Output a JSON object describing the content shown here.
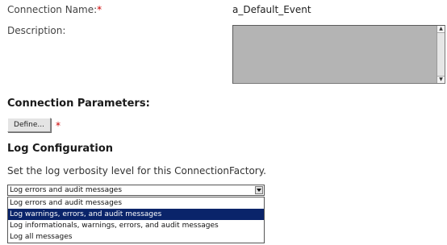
{
  "connection_name": {
    "label": "Connection Name:",
    "required_mark": "*",
    "value": "a_Default_Event"
  },
  "description": {
    "label": "Description:",
    "value": ""
  },
  "connection_parameters": {
    "heading": "Connection Parameters:",
    "define_label": "Define...",
    "required_mark": "*"
  },
  "log_configuration": {
    "heading": "Log Configuration",
    "description": "Set the log verbosity level for this ConnectionFactory.",
    "selected_value": "Log errors and audit messages",
    "options": [
      "Log errors and audit messages",
      "Log warnings, errors, and audit messages",
      "Log informationals, warnings, errors, and audit messages",
      "Log all messages"
    ],
    "highlighted_index": 1
  },
  "colors": {
    "required": "#cc0000",
    "selection_background": "#0a246a",
    "textarea_background": "#b4b4b4"
  }
}
